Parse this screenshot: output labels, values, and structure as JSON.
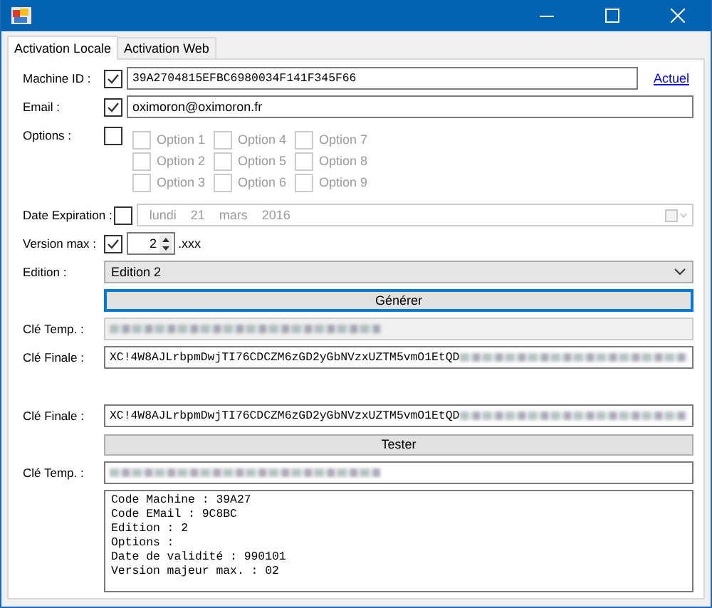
{
  "tabs": [
    {
      "label": "Activation Locale",
      "selected": true
    },
    {
      "label": "Activation Web",
      "selected": false
    }
  ],
  "generate": [
    {
      "kind": "check_text",
      "label": "Machine ID :",
      "checked": true,
      "value": "39A2704815EFBC6980034F141F345F66",
      "mono": true,
      "link": "Actuel"
    },
    {
      "kind": "check_text",
      "label": "Email :",
      "checked": true,
      "value": "oximoron@oximoron.fr",
      "mono": false
    },
    {
      "kind": "options",
      "label": "Options :",
      "checked": false,
      "disabled": true,
      "options": [
        {
          "label": "Option 1",
          "checked": false
        },
        {
          "label": "Option 2",
          "checked": false
        },
        {
          "label": "Option 3",
          "checked": false
        },
        {
          "label": "Option 4",
          "checked": false
        },
        {
          "label": "Option 5",
          "checked": false
        },
        {
          "label": "Option 6",
          "checked": false
        },
        {
          "label": "Option 7",
          "checked": false
        },
        {
          "label": "Option 8",
          "checked": false
        },
        {
          "label": "Option 9",
          "checked": false
        }
      ]
    },
    {
      "kind": "date",
      "label": "Date Expiration :",
      "checked": false,
      "disabled": true,
      "parts": [
        "lundi",
        "21",
        "mars",
        "2016"
      ]
    },
    {
      "kind": "version",
      "label": "Version max :",
      "checked": true,
      "value": "2",
      "suffix": ".xxx"
    },
    {
      "kind": "combo",
      "label": "Edition :",
      "value": "Edition 2"
    },
    {
      "kind": "button",
      "label": "Générer",
      "focused": true
    },
    {
      "kind": "text",
      "label": "Clé Temp. :",
      "disabled": true,
      "blurred": true
    },
    {
      "kind": "text",
      "label": "Clé Finale :",
      "value": "XC!4W8AJLrbpmDwjTI76CDCZM6zGD2yGbNVzxUZTM5vmO1EtQD",
      "disabled": false,
      "blurred": true
    }
  ],
  "test": [
    {
      "kind": "text",
      "label": "Clé Finale :",
      "value": "XC!4W8AJLrbpmDwjTI76CDCZM6zGD2yGbNVzxUZTM5vmO1EtQD",
      "disabled": false,
      "blurred": true
    },
    {
      "kind": "button",
      "label": "Tester",
      "focused": false
    },
    {
      "kind": "text",
      "label": "Clé Temp. :",
      "disabled": false,
      "blurred": true
    },
    {
      "kind": "textarea",
      "lines": [
        "Code Machine : 39A27",
        "Code EMail : 9C8BC",
        "Edition : 2",
        "Options :",
        "Date de validité : 990101",
        "Version majeur max. : 02"
      ]
    }
  ]
}
